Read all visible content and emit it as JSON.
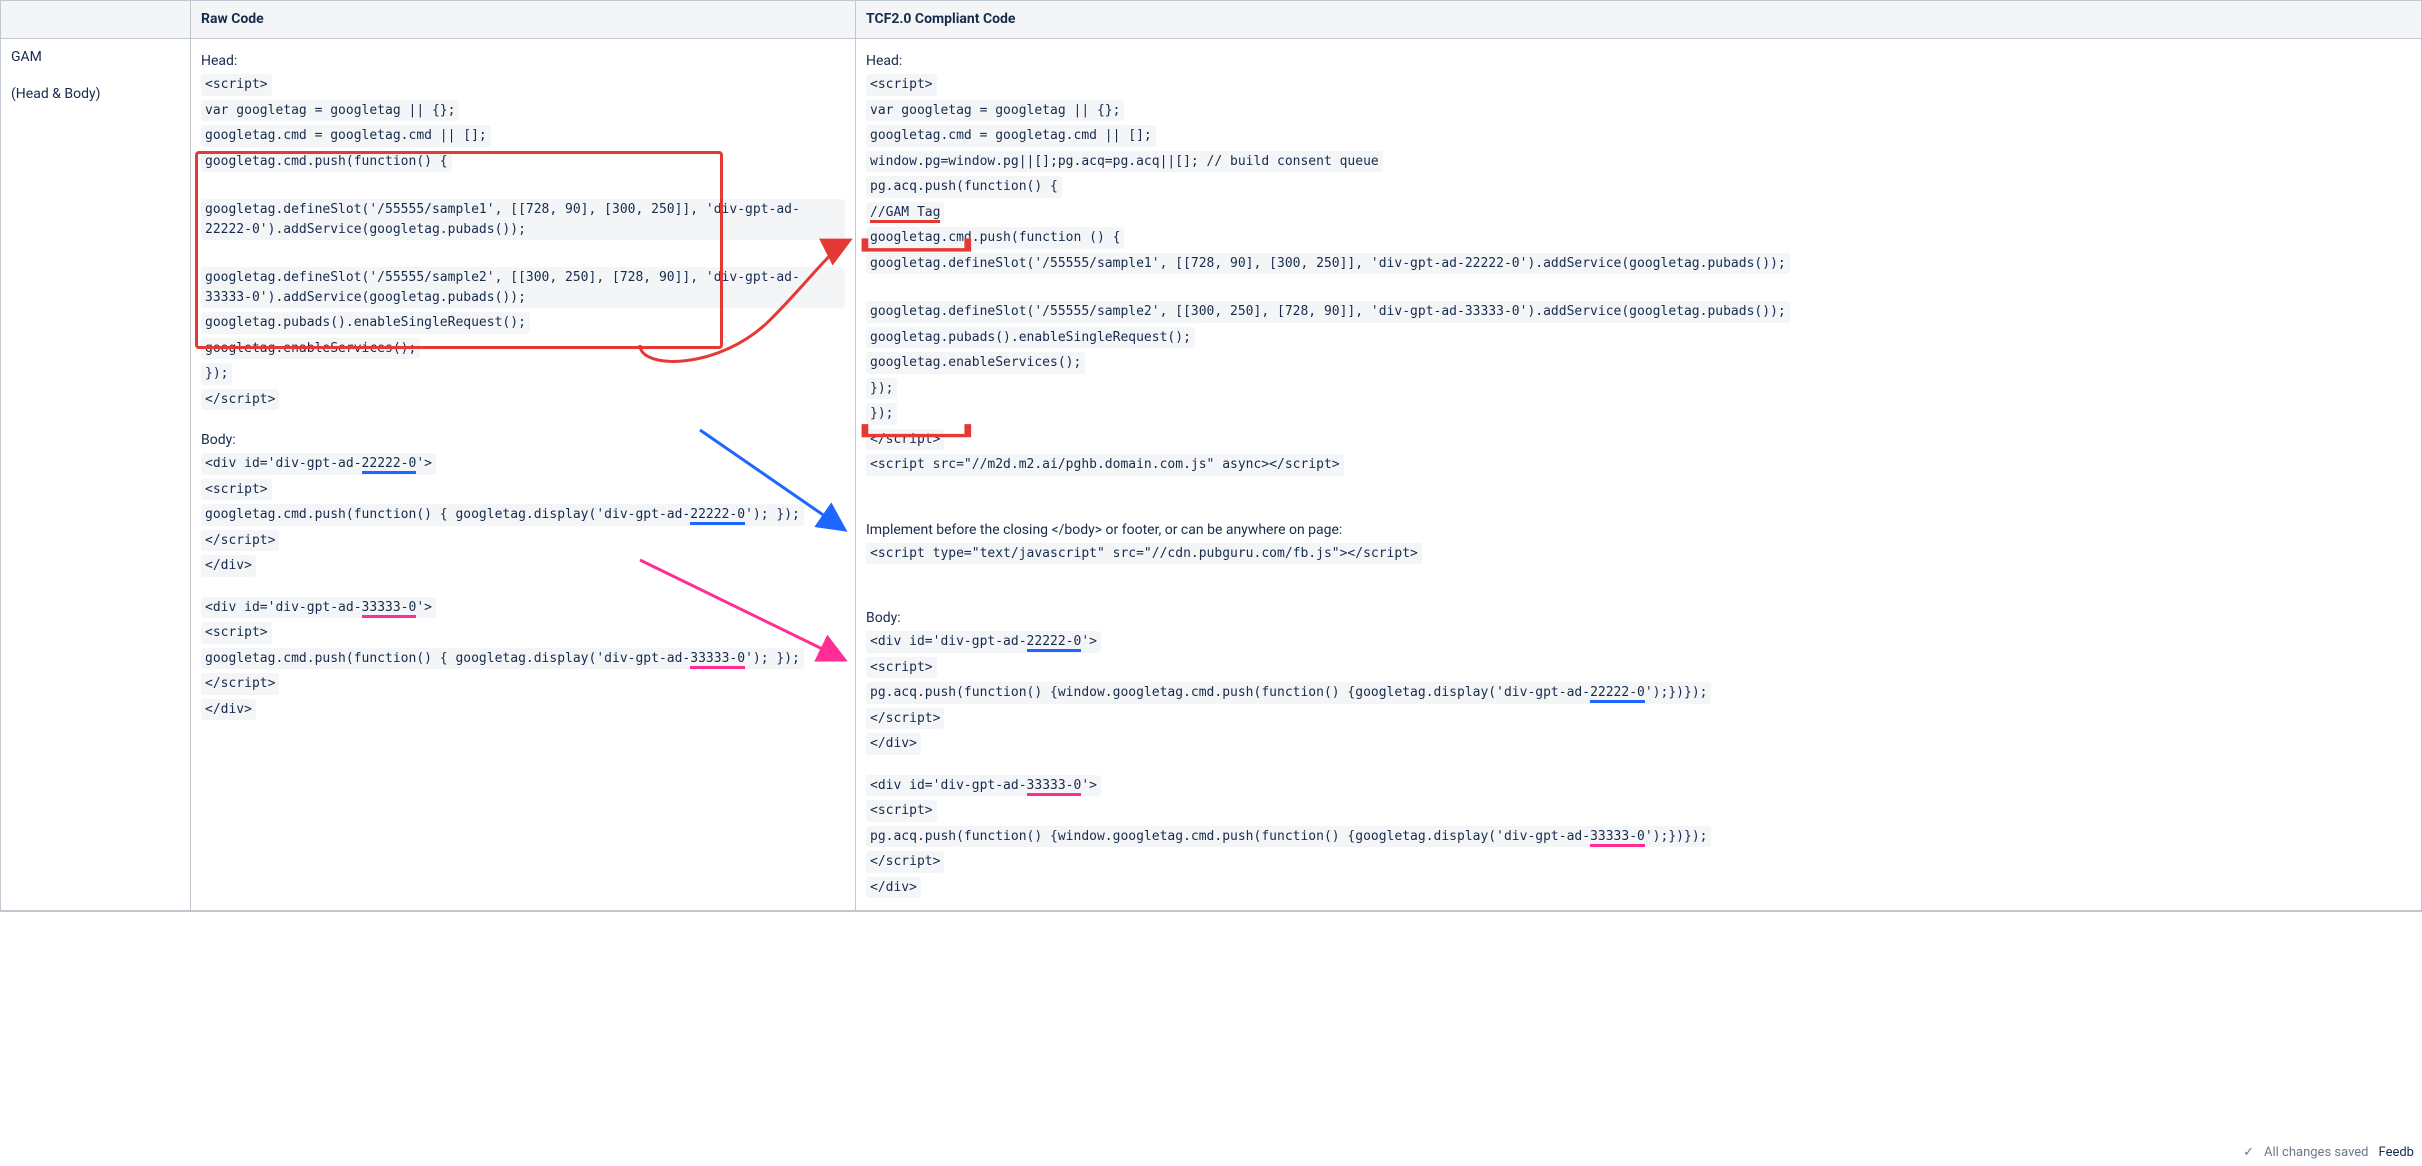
{
  "columns": {
    "blank": "",
    "raw": "Raw Code",
    "compliant": "TCF2.0 Compliant Code"
  },
  "row_label": {
    "main": "GAM",
    "sub": "(Head & Body)"
  },
  "raw": {
    "head_label": "Head:",
    "lines": [
      "<script>",
      "var googletag = googletag || {};",
      "googletag.cmd = googletag.cmd || [];",
      "googletag.cmd.push(function() {",
      "",
      "googletag.defineSlot('/55555/sample1', [[728, 90], [300, 250]], 'div-gpt-ad-22222-0').addService(googletag.pubads());",
      "",
      "googletag.defineSlot('/55555/sample2', [[300, 250], [728, 90]], 'div-gpt-ad-33333-0').addService(googletag.pubads());",
      "googletag.pubads().enableSingleRequest();",
      "googletag.enableServices();",
      "});",
      "</script>"
    ],
    "body_label": "Body:",
    "body1_pre": "<div id='div-gpt-ad-",
    "body1_hl": "22222-0",
    "body1_post": "'>",
    "body1_script_open": "<script>",
    "body1_push_pre": "googletag.cmd.push(function() { googletag.display('div-gpt-ad-",
    "body1_push_hl": "22222-0",
    "body1_push_post": "'); });",
    "body1_script_close": "</script>",
    "body1_div_close": "</div>",
    "body2_pre": "<div id='div-gpt-ad-",
    "body2_hl": "33333-0",
    "body2_post": "'>",
    "body2_script_open": "<script>",
    "body2_push_pre": "googletag.cmd.push(function() { googletag.display('div-gpt-ad-",
    "body2_push_hl": "33333-0",
    "body2_push_post": "'); });",
    "body2_script_close": "</script>",
    "body2_div_close": "</div>"
  },
  "compliant": {
    "head_label": "Head:",
    "lines_pre": [
      "<script>",
      "var googletag = googletag || {};",
      "googletag.cmd = googletag.cmd || [];",
      "window.pg=window.pg||[];pg.acq=pg.acq||[]; // build consent queue",
      "pg.acq.push(function() {"
    ],
    "gam_tag_label": "//GAM Tag",
    "lines_block": [
      "googletag.cmd.push(function () {",
      "googletag.defineSlot('/55555/sample1', [[728, 90], [300, 250]], 'div-gpt-ad-22222-0').addService(googletag.pubads());",
      "",
      "googletag.defineSlot('/55555/sample2', [[300, 250], [728, 90]], 'div-gpt-ad-33333-0').addService(googletag.pubads());",
      "googletag.pubads().enableSingleRequest();",
      "googletag.enableServices();",
      "});"
    ],
    "lines_post": [
      "});",
      "</script>",
      "<script src=\"//m2d.m2.ai/pghb.domain.com.js\" async></script>"
    ],
    "implement_note": "Implement before the closing </body> or footer, or can be anywhere on page:",
    "cdn_script": "<script type=\"text/javascript\" src=\"//cdn.pubguru.com/fb.js\"></script>",
    "body_label": "Body:",
    "body1_pre": "<div id='div-gpt-ad-",
    "body1_hl": "22222-0",
    "body1_post": "'>",
    "body1_script_open": "<script>",
    "body1_push_pre": "pg.acq.push(function() {window.googletag.cmd.push(function() {googletag.display('div-gpt-ad-",
    "body1_push_hl": "22222-0",
    "body1_push_post": "');})});",
    "body1_script_close": "</script>",
    "body1_div_close": "</div>",
    "body2_pre": "<div id='div-gpt-ad-",
    "body2_hl": "33333-0",
    "body2_post": "'>",
    "body2_script_open": "<script>",
    "body2_push_pre": "pg.acq.push(function() {window.googletag.cmd.push(function() {googletag.display('div-gpt-ad-",
    "body2_push_hl": "33333-0",
    "body2_push_post": "');})});",
    "body2_script_close": "</script>",
    "body2_div_close": "</div>"
  },
  "footer": {
    "saved": "All changes saved",
    "feedback": "Feedb"
  }
}
